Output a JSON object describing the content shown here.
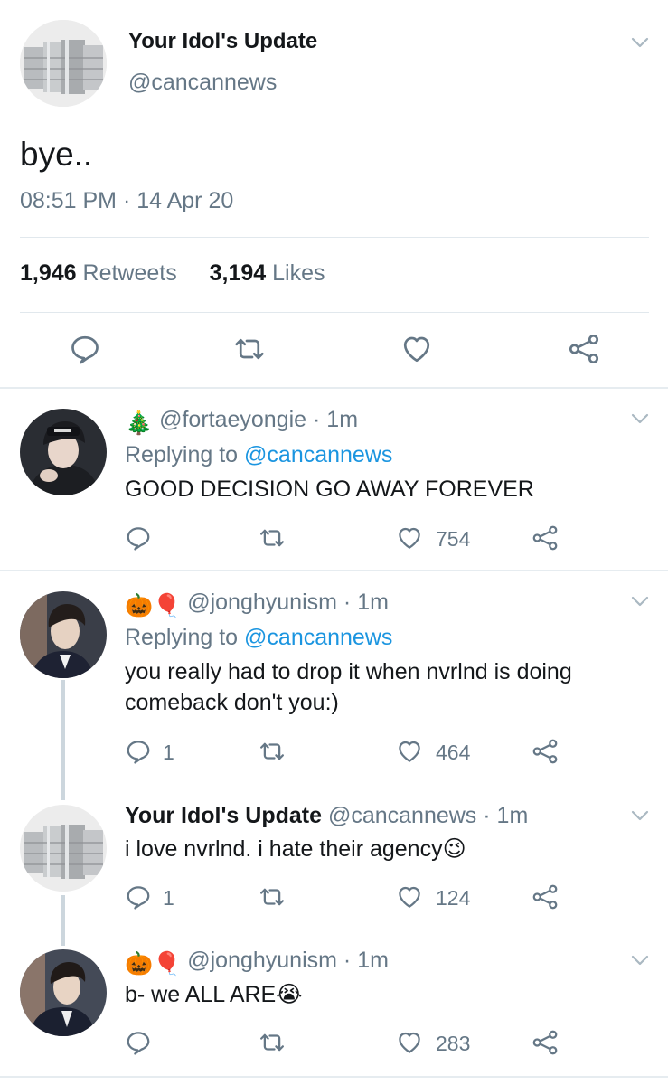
{
  "main_tweet": {
    "display_name": "Your Idol's Update",
    "handle": "@cancannews",
    "text": "bye..",
    "timestamp": "08:51 PM · 14 Apr 20",
    "retweets_count": "1,946",
    "retweets_label": "Retweets",
    "likes_count": "3,194",
    "likes_label": "Likes",
    "actions": [
      "reply-icon",
      "retweet-icon",
      "like-icon",
      "share-icon"
    ]
  },
  "replies": [
    {
      "emoji": "🎄",
      "handle": "@fortaeyongie",
      "time": "· 1m",
      "replying_prefix": "Replying to ",
      "replying_to": "@cancannews",
      "text": "GOOD DECISION GO AWAY FOREVER",
      "reply_count": "",
      "like_count": "754"
    },
    {
      "emoji": "🎃🎈",
      "handle": "@jonghyunism",
      "time": "· 1m",
      "replying_prefix": "Replying to ",
      "replying_to": "@cancannews",
      "text_line1": "you really had to drop it when nvrlnd is doing",
      "text_line2": "comeback don't you:)",
      "reply_count": "1",
      "like_count": "464"
    },
    {
      "display_name": "Your Idol's Update",
      "handle": "@cancannews",
      "time": "· 1m",
      "text": "i love nvrlnd. i hate their agency😉",
      "reply_count": "1",
      "like_count": "124"
    },
    {
      "emoji": "🎃🎈",
      "handle": "@jonghyunism",
      "time": "· 1m",
      "text": "b- we ALL ARE😭",
      "reply_count": "",
      "like_count": "283"
    }
  ],
  "colors": {
    "text": "#14171a",
    "secondary": "#657786",
    "link": "#1b95e0",
    "divider": "#e6ecf0",
    "thread_line": "#ccd6dd"
  }
}
